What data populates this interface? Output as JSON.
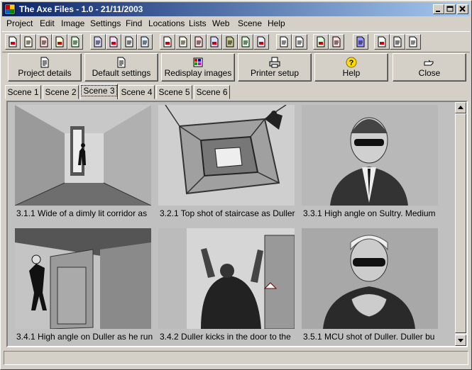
{
  "window": {
    "title": "The Axe Files - 1.0 - 21/11/2003"
  },
  "menu": [
    "Project",
    "Edit",
    "Image",
    "Settings",
    "Find",
    "Locations",
    "Lists",
    "Web",
    "Scene",
    "Help"
  ],
  "toolbar_icons": [
    "new-doc-icon",
    "open-doc-icon",
    "print-doc-icon",
    "folder-icon",
    "folders-icon",
    "scissors-icon",
    "copy-icon",
    "paste-icon",
    "swap-icon",
    "blank-doc-icon",
    "pages-icon",
    "print-icon",
    "multi-print-icon",
    "pencil-icon",
    "play-icon",
    "document-set-icon",
    "font-icon",
    "text-doc-icon",
    "link-icon",
    "reload-icon",
    "globe-icon",
    "printer-icon",
    "printer-alt-icon",
    "printer-list-icon"
  ],
  "buttons": {
    "project_details": "Project details",
    "default_settings": "Default settings",
    "redisplay_images": "Redisplay images",
    "printer_setup": "Printer setup",
    "help": "Help",
    "close": "Close"
  },
  "tabs": [
    "Scene 1",
    "Scene 2",
    "Scene 3",
    "Scene 4",
    "Scene 5",
    "Scene 6"
  ],
  "active_tab": "Scene 3",
  "shots": [
    {
      "caption": "3.1.1  Wide of a dimly lit corridor as",
      "sketch": "corridor"
    },
    {
      "caption": "3.2.1  Top shot of staircase as Duller",
      "sketch": "staircase"
    },
    {
      "caption": "3.3.1  High angle on Sultry. Medium",
      "sketch": "portrait"
    },
    {
      "caption": "3.4.1  High angle on Duller as he run",
      "sketch": "running"
    },
    {
      "caption": "3.4.2  Duller kicks in the door to the",
      "sketch": "door"
    },
    {
      "caption": "3.5.1  MCU shot of Duller. Duller bu",
      "sketch": "mcu"
    }
  ],
  "colors": {
    "titlebar_start": "#0a246a",
    "titlebar_end": "#a6caf0",
    "chrome": "#d4d0c8"
  }
}
